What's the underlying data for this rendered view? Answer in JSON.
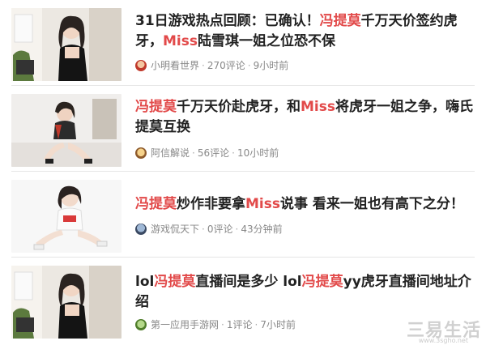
{
  "colors": {
    "highlight": "#e24a4a",
    "title": "#222222",
    "meta": "#888888"
  },
  "articles": [
    {
      "title_parts": [
        "31日游戏热点回顾：已确认！",
        "冯提莫",
        "千万天价签约虎牙，",
        "Miss",
        "陆雪琪一姐之位恐不保"
      ],
      "source": "小明看世界",
      "comments": "270评论",
      "time": "9小时前",
      "avatar_icon": "cartoon-avatar-icon"
    },
    {
      "title_parts": [
        "",
        "冯提莫",
        "千万天价赴虎牙，和",
        "Miss",
        "将虎牙一姐之争，嗨氏提莫互换"
      ],
      "source": "阿信解说",
      "comments": "56评论",
      "time": "10小时前",
      "avatar_icon": "cartoon-avatar-icon"
    },
    {
      "title_parts": [
        "",
        "冯提莫",
        "炒作非要拿",
        "Miss",
        "说事 看来一姐也有高下之分！"
      ],
      "source": "游戏侃天下",
      "comments": "0评论",
      "time": "43分钟前",
      "avatar_icon": "game-avatar-icon"
    },
    {
      "title_parts": [
        "lol",
        "冯提莫",
        "直播间是多少 lol",
        "冯提莫",
        "yy虎牙直播间地址介绍"
      ],
      "source": "第一应用手游网",
      "comments": "1评论",
      "time": "7小时前",
      "avatar_icon": "app-avatar-icon"
    }
  ],
  "watermark": {
    "text": "三易生活",
    "url": "www.3sgho.net"
  }
}
